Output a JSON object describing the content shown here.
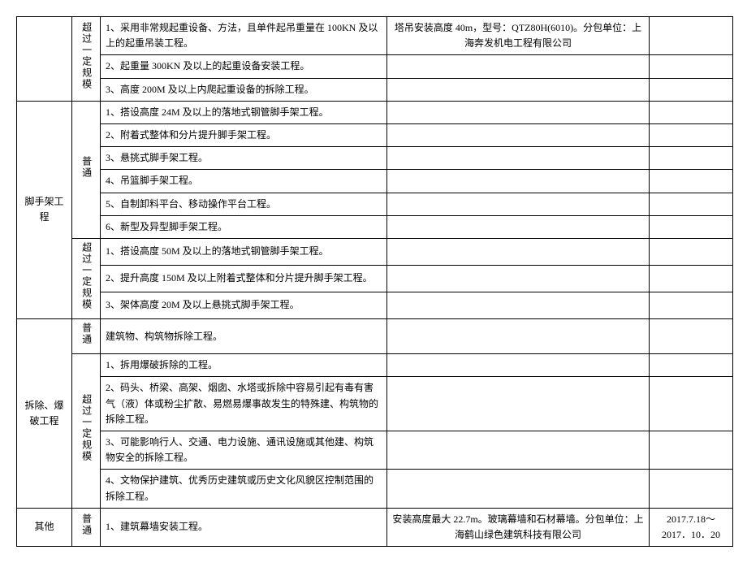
{
  "section1": {
    "sub": "超过一定规模",
    "r1": "1、采用非常规起重设备、方法，且单件起吊重量在 100KN 及以上的起重吊装工程。",
    "r1note": "塔吊安装高度 40m，型号：QTZ80H(6010)。分包单位：上海奔发机电工程有限公司",
    "r2": "2、起重量 300KN 及以上的起重设备安装工程。",
    "r3": "3、高度 200M 及以上内爬起重设备的拆除工程。"
  },
  "section2": {
    "cat": "脚手架工程",
    "subA": "普通",
    "a1": "1、搭设高度 24M 及以上的落地式钢管脚手架工程。",
    "a2": "2、附着式整体和分片提升脚手架工程。",
    "a3": "3、悬挑式脚手架工程。",
    "a4": "4、吊篮脚手架工程。",
    "a5": "5、自制卸料平台、移动操作平台工程。",
    "a6": "6、新型及异型脚手架工程。",
    "subB": "超过一定规模",
    "b1": "1、搭设高度 50M 及以上的落地式钢管脚手架工程。",
    "b2": "2、提升高度 150M 及以上附着式整体和分片提升脚手架工程。",
    "b3": "3、架体高度 20M 及以上悬挑式脚手架工程。"
  },
  "section3": {
    "cat": "拆除、爆破工程",
    "subA": "普通",
    "a1": "建筑物、构筑物拆除工程。",
    "subB": "超过一定规模",
    "b1": "1、拆用爆破拆除的工程。",
    "b2": "2、码头、桥梁、高架、烟囱、水塔或拆除中容易引起有毒有害气（液）体或粉尘扩散、易燃易爆事故发生的特殊建、构筑物的拆除工程。",
    "b3": "3、可能影响行人、交通、电力设施、通讯设施或其他建、构筑物安全的拆除工程。",
    "b4": "4、文物保护建筑、优秀历史建筑或历史文化风貌区控制范围的拆除工程。"
  },
  "section4": {
    "cat": "其他",
    "sub": "普通",
    "r1": "1、建筑幕墙安装工程。",
    "r1note1": "安装高度最大 22.7m。玻璃幕墙和石材幕墙。分包单位：上海鹤山绿色建筑科技有限公司",
    "r1note2": "2017.7.18～2017．10．20"
  }
}
